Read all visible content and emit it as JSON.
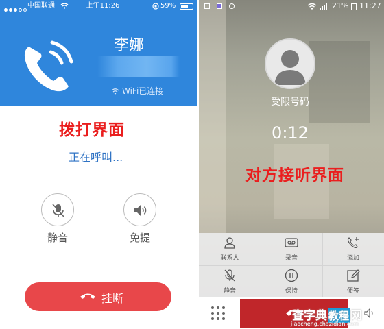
{
  "dialing_screen": {
    "status_bar": {
      "carrier": "中国联通",
      "time": "上午11:26",
      "battery_percent": "59%"
    },
    "contact_name": "李娜",
    "connection": "WiFi已连接",
    "annotation": "拨打界面",
    "status": "正在呼叫...",
    "buttons": {
      "mute_label": "静音",
      "speaker_label": "免提",
      "hangup_label": "挂断"
    },
    "colors": {
      "header": "#2f86dc",
      "hangup": "#e8474a",
      "annotation": "#ea1e1e"
    }
  },
  "answered_screen": {
    "status_bar": {
      "battery_percent": "21%",
      "time": "11:27"
    },
    "caller": "受限号码",
    "timer": "0:12",
    "annotation": "对方接听界面",
    "actions": [
      {
        "label": "联系人",
        "icon": "contacts-icon"
      },
      {
        "label": "录音",
        "icon": "record-icon"
      },
      {
        "label": "添加",
        "icon": "add-call-icon"
      },
      {
        "label": "静音",
        "icon": "mute-icon"
      },
      {
        "label": "保持",
        "icon": "hold-icon"
      },
      {
        "label": "便签",
        "icon": "note-icon"
      }
    ],
    "colors": {
      "end_button": "#c0262a"
    }
  },
  "watermark": {
    "main_left": "查字典",
    "main_mid": "教程",
    "main_right": "网",
    "url": "jiaocheng.chazidian.com"
  }
}
